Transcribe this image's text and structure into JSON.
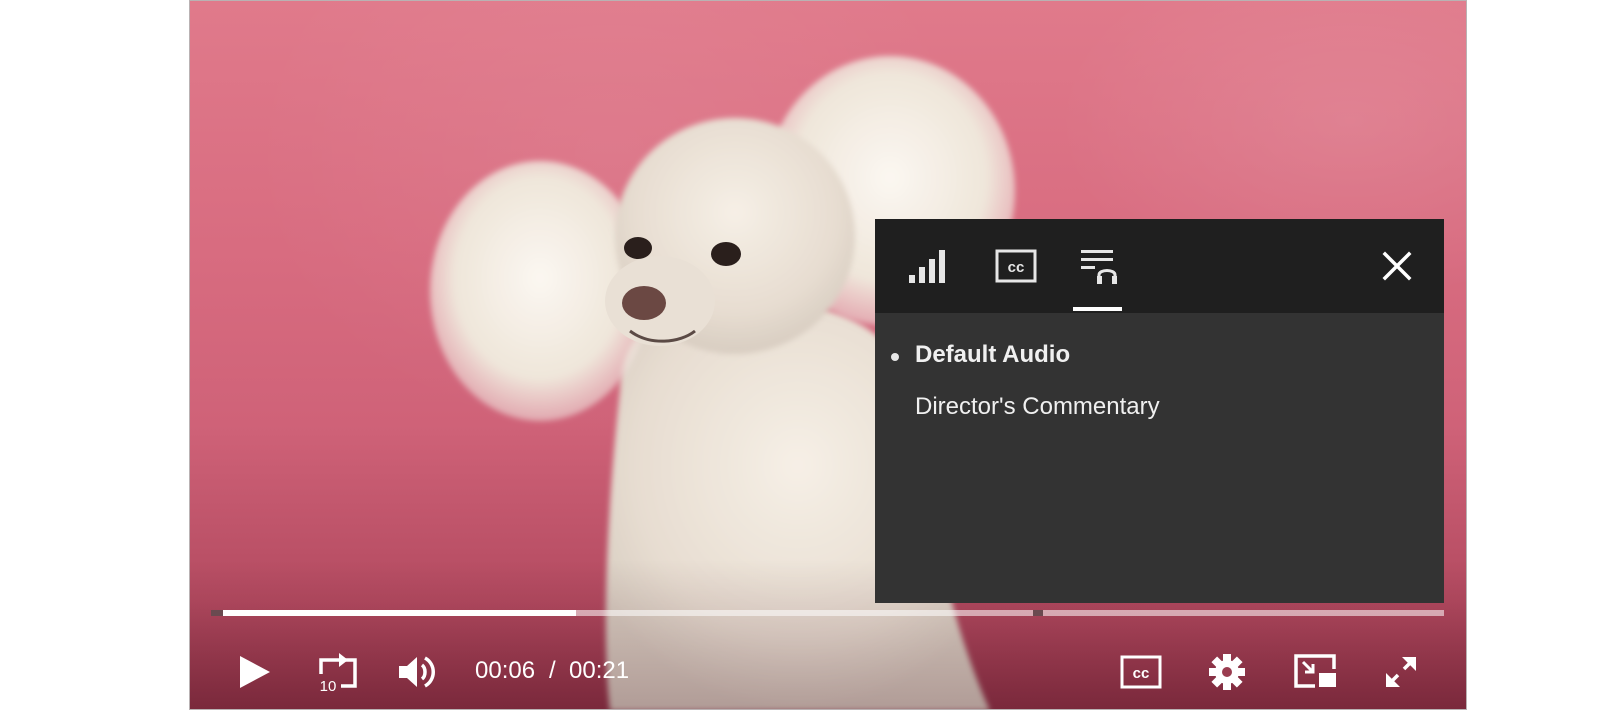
{
  "player": {
    "current_time": "00:06",
    "time_separator": "/",
    "duration": "00:21",
    "progress_fraction": 0.286,
    "marker_fraction": 0.667
  },
  "settings_panel": {
    "tabs": [
      {
        "name": "quality",
        "icon": "signal-bars-icon",
        "active": false
      },
      {
        "name": "captions",
        "icon": "cc-icon",
        "active": false
      },
      {
        "name": "audio",
        "icon": "audio-track-icon",
        "active": true
      }
    ],
    "options": [
      {
        "label": "Default Audio",
        "selected": true
      },
      {
        "label": "Director's Commentary",
        "selected": false
      }
    ]
  },
  "controls": {
    "left": [
      "play-icon",
      "replay-10-icon",
      "volume-icon"
    ],
    "right": [
      "cc-icon",
      "gear-icon",
      "picture-in-picture-icon",
      "fullscreen-icon"
    ],
    "replay_seconds": "10"
  },
  "colors": {
    "backdrop": "#d9697c",
    "panel_header": "#1f1f1f",
    "panel_body": "#333333",
    "progress_played": "#ffffff"
  }
}
